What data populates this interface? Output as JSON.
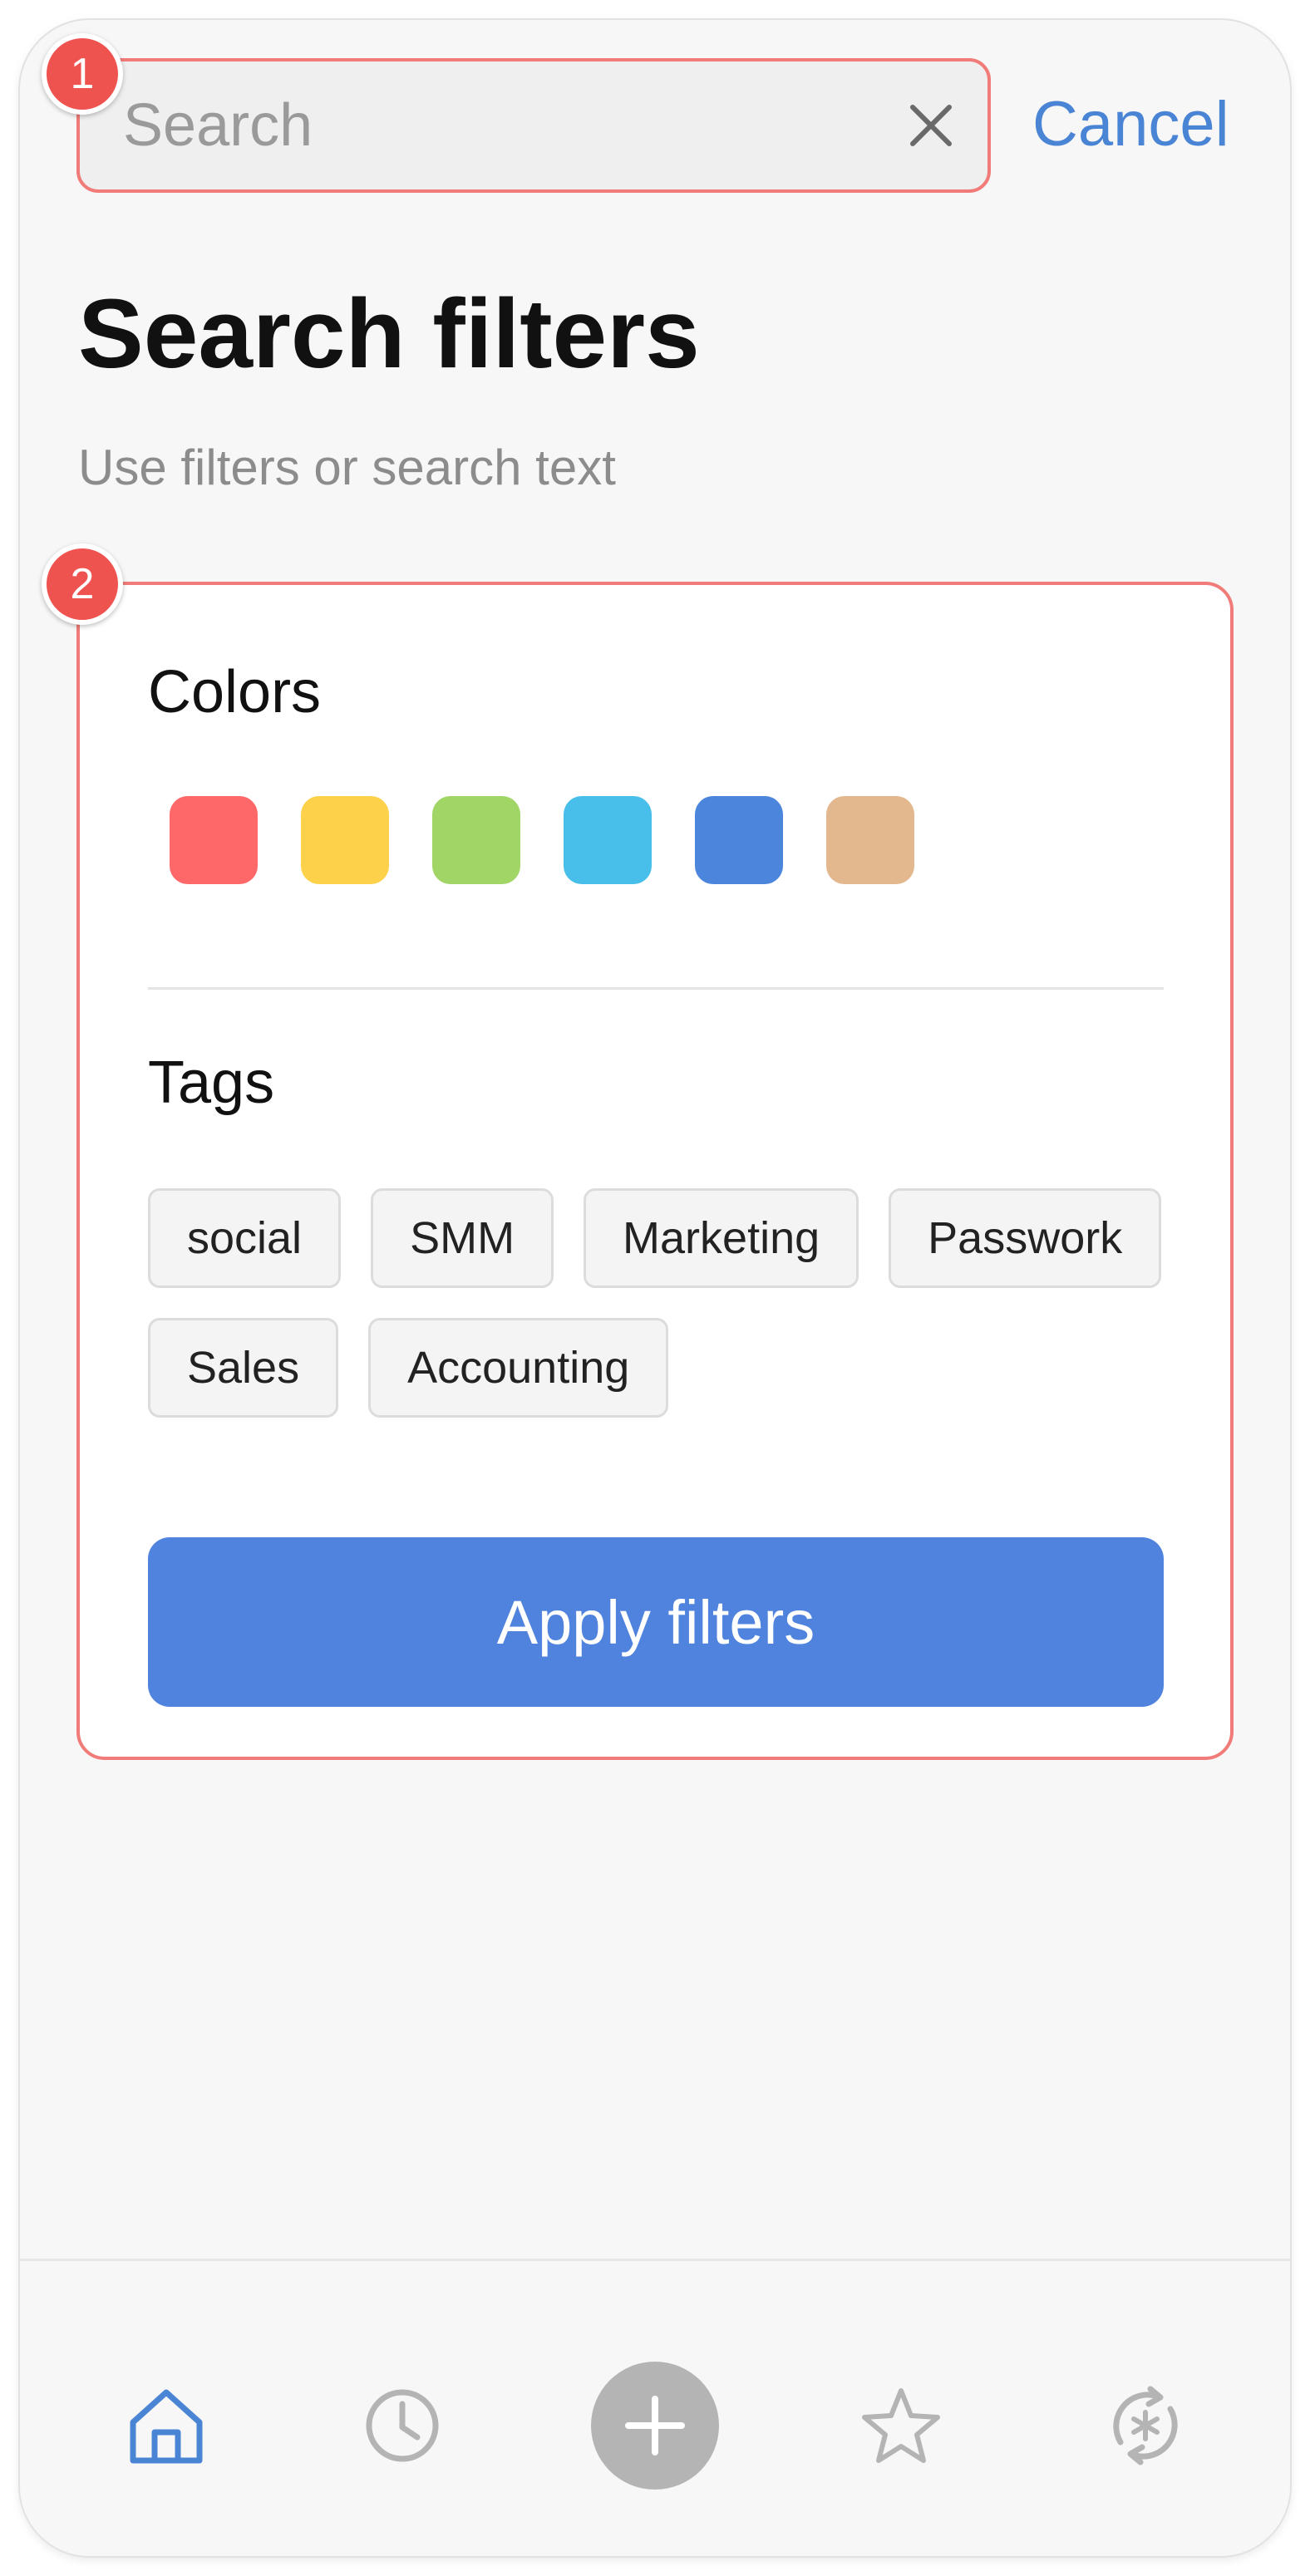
{
  "search": {
    "placeholder": "Search",
    "value": "",
    "clear_icon": "close-icon",
    "cancel_label": "Cancel"
  },
  "badges": [
    "1",
    "2"
  ],
  "page": {
    "title": "Search filters",
    "subtitle": "Use filters or search text"
  },
  "filters": {
    "colors_title": "Colors",
    "colors": [
      {
        "name": "red",
        "hex": "#ff6868"
      },
      {
        "name": "yellow",
        "hex": "#fdd14a"
      },
      {
        "name": "green",
        "hex": "#a1d666"
      },
      {
        "name": "light-blue",
        "hex": "#48bfeb"
      },
      {
        "name": "blue",
        "hex": "#4b86dc"
      },
      {
        "name": "tan",
        "hex": "#e4b88f"
      }
    ],
    "tags_title": "Tags",
    "tags": [
      "social",
      "SMM",
      "Marketing",
      "Passwork",
      "Sales",
      "Accounting"
    ],
    "apply_label": "Apply filters"
  },
  "bottom_nav": [
    {
      "icon": "home-icon",
      "active": true
    },
    {
      "icon": "clock-icon",
      "active": false
    },
    {
      "icon": "plus-icon",
      "active": false
    },
    {
      "icon": "star-icon",
      "active": false
    },
    {
      "icon": "sync-icon",
      "active": false
    }
  ],
  "colors": {
    "accent": "#4f83de",
    "link": "#4a84d4",
    "highlight_border": "#f07b78",
    "badge": "#ef5350",
    "nav_inactive": "#b4b4b4"
  }
}
